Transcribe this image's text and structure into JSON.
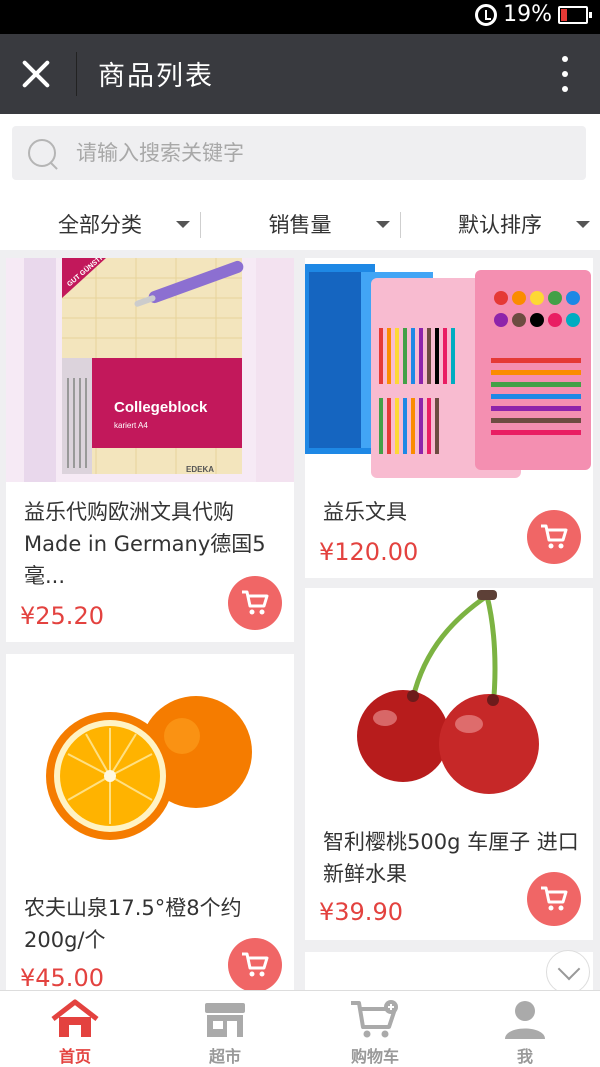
{
  "status_bar": {
    "battery": "19%",
    "icons": [
      "alarm-icon",
      "battery-icon"
    ]
  },
  "header": {
    "title": "商品列表",
    "close_icon": "close-icon",
    "more_icon": "more-vertical-icon"
  },
  "search": {
    "placeholder": "请输入搜索关键字",
    "icon": "search-icon"
  },
  "filters": [
    {
      "label": "全部分类"
    },
    {
      "label": "销售量"
    },
    {
      "label": "默认排序"
    }
  ],
  "products": [
    {
      "name": "益乐代购欧洲文具代购Made in Germany德国5毫...",
      "price": "¥25.20"
    },
    {
      "name": "益乐文具",
      "price": "¥120.00"
    },
    {
      "name": "农夫山泉17.5°橙8个约200g/个",
      "price": "¥45.00"
    },
    {
      "name": "智利樱桃500g 车厘子 进口新鲜水果",
      "price": "¥39.90"
    }
  ],
  "notebook_image": {
    "brand_text": "Collegeblock",
    "sub_text": "kariert A4",
    "corner_badge": "GUT GÜNSTIG",
    "store": "EDEKA"
  },
  "bottom_nav": [
    {
      "label": "首页",
      "icon": "home-icon"
    },
    {
      "label": "超市",
      "icon": "store-icon"
    },
    {
      "label": "购物车",
      "icon": "cart-icon"
    },
    {
      "label": "我",
      "icon": "user-icon"
    }
  ],
  "colors": {
    "accent": "#e3423f",
    "cart_button": "#f06666",
    "header_bg": "#393a3f"
  }
}
